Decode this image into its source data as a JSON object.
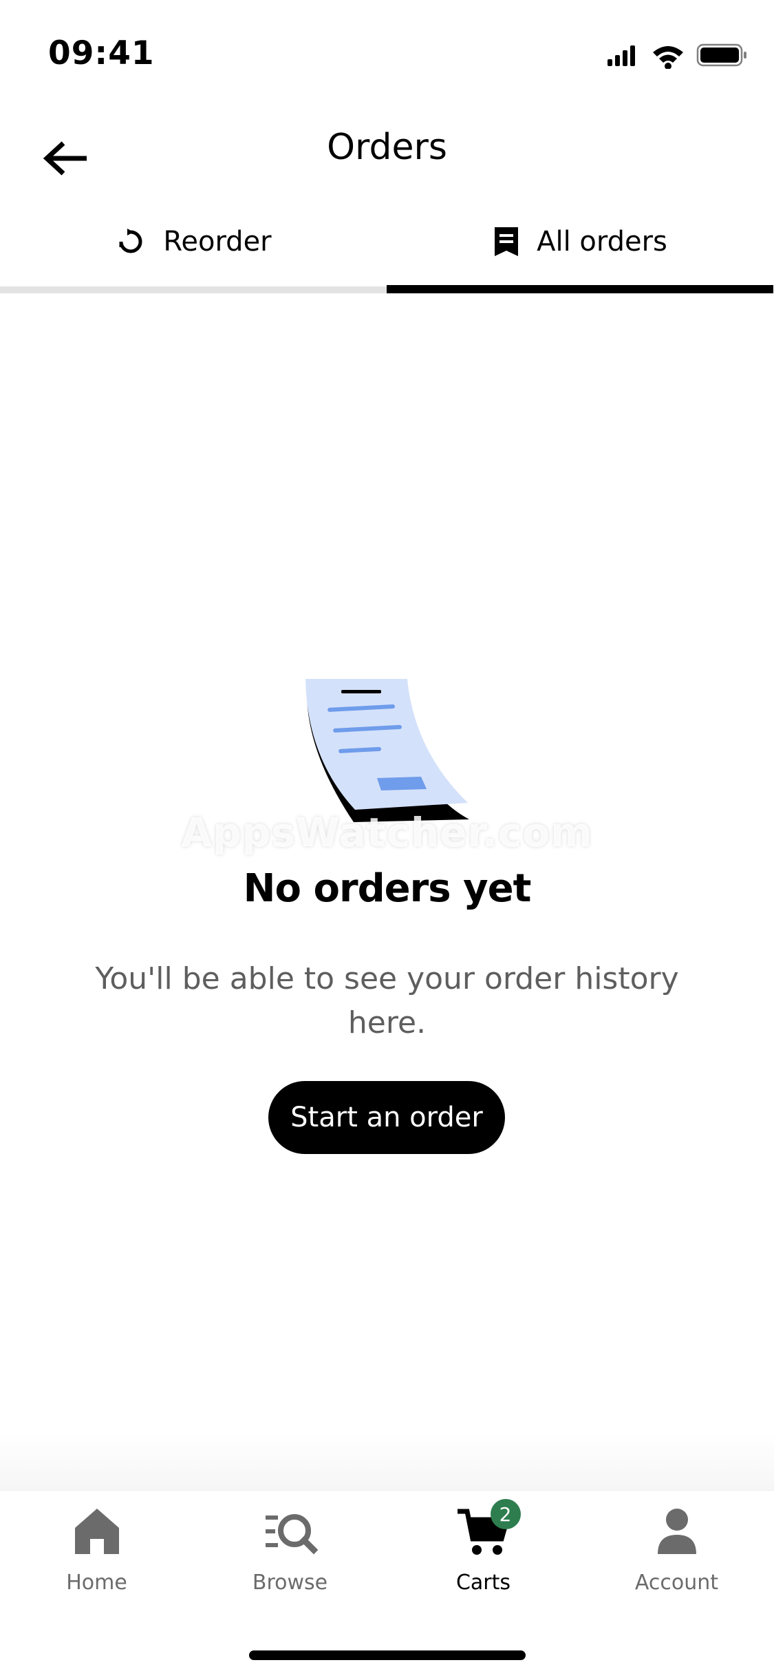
{
  "status_bar": {
    "time": "09:41",
    "icons": [
      "cellular-signal-icon",
      "wifi-icon",
      "battery-icon"
    ]
  },
  "header": {
    "back_icon": "back-arrow-icon",
    "title": "Orders"
  },
  "tabs": [
    {
      "label": "Reorder",
      "icon": "reorder-icon",
      "active": false
    },
    {
      "label": "All orders",
      "icon": "receipt-icon",
      "active": true
    }
  ],
  "empty_state": {
    "illustration": "receipt-illustration",
    "watermark": "AppsWatcher.com",
    "title": "No orders yet",
    "description": "You'll be able to see your order history here.",
    "button_label": "Start an order"
  },
  "bottom_nav": {
    "items": [
      {
        "label": "Home",
        "icon": "home-icon",
        "active": false
      },
      {
        "label": "Browse",
        "icon": "browse-icon",
        "active": false
      },
      {
        "label": "Carts",
        "icon": "cart-icon",
        "active": true,
        "badge": "2"
      },
      {
        "label": "Account",
        "icon": "account-icon",
        "active": false
      }
    ]
  },
  "colors": {
    "accent": "#000000",
    "badge": "#2e7d4f",
    "muted_text": "#5e5e5e",
    "inactive_nav": "#6b6b6b",
    "illustration_paper": "#d4e1fa",
    "illustration_lines": "#6f9ceb"
  }
}
